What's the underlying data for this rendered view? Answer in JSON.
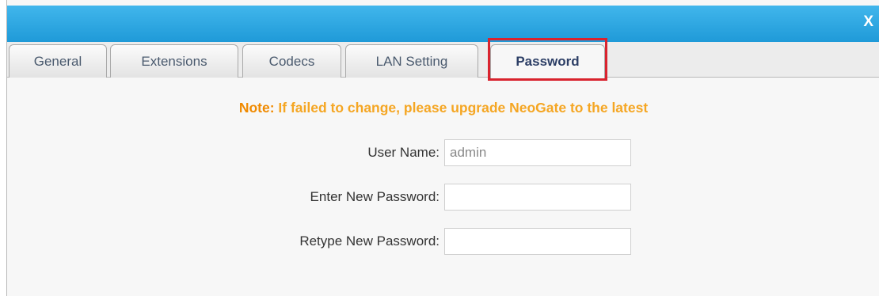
{
  "dialog": {
    "close_label": "X"
  },
  "tabs": [
    {
      "label": "General",
      "active": false
    },
    {
      "label": "Extensions",
      "active": false
    },
    {
      "label": "Codecs",
      "active": false
    },
    {
      "label": "LAN Setting",
      "active": false
    },
    {
      "label": "Password",
      "active": true
    }
  ],
  "note": {
    "prefix": "Note:",
    "text": " If failed to change, please upgrade NeoGate to the latest"
  },
  "form": {
    "username": {
      "label": "User Name:",
      "value": "admin"
    },
    "new_password": {
      "label": "Enter New Password:",
      "value": ""
    },
    "retype_password": {
      "label": "Retype New Password:",
      "value": ""
    }
  },
  "colors": {
    "titlebar": "#2aa6e1",
    "note": "#f5a623",
    "highlight": "#d9232e"
  }
}
